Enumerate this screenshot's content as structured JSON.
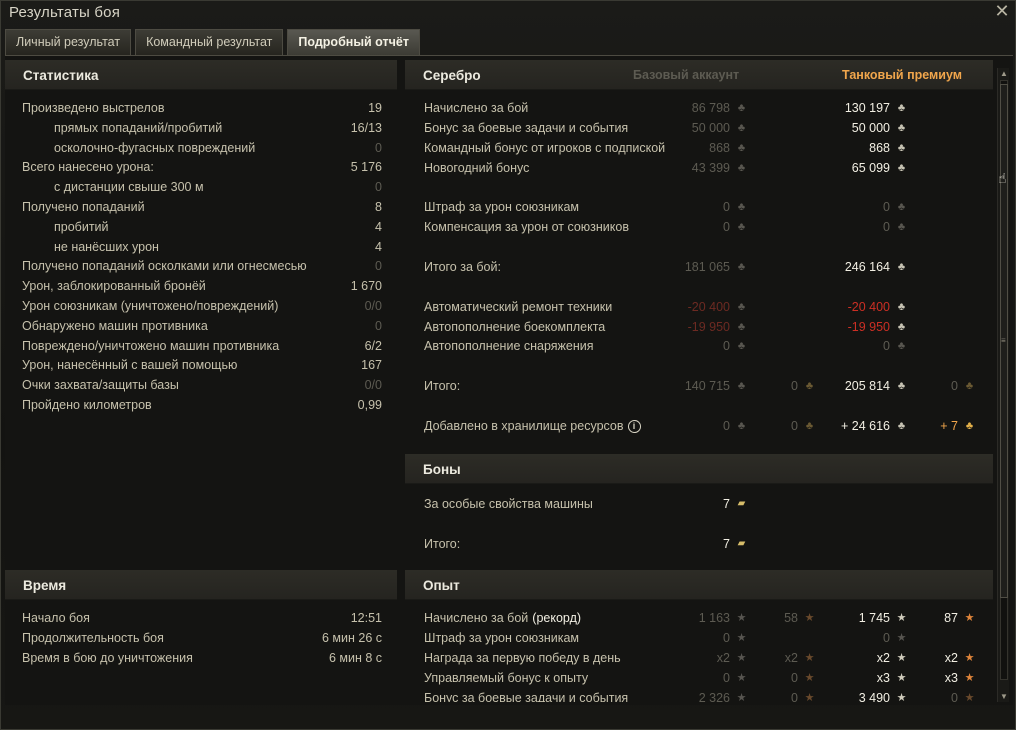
{
  "window": {
    "title": "Результаты боя"
  },
  "tabs": [
    {
      "label": "Личный результат",
      "active": false
    },
    {
      "label": "Командный результат",
      "active": false
    },
    {
      "label": "Подробный отчёт",
      "active": true
    }
  ],
  "statistics": {
    "header": "Статистика",
    "rows": [
      {
        "label": "Произведено выстрелов",
        "value": "19",
        "indent": false,
        "dim": false
      },
      {
        "label": "прямых попаданий/пробитий",
        "value": "16/13",
        "indent": true,
        "dim": false
      },
      {
        "label": "осколочно-фугасных повреждений",
        "value": "0",
        "indent": true,
        "dim": true
      },
      {
        "label": "Всего нанесено урона:",
        "value": "5 176",
        "indent": false,
        "dim": false
      },
      {
        "label": "с дистанции свыше 300 м",
        "value": "0",
        "indent": true,
        "dim": true
      },
      {
        "label": "Получено попаданий",
        "value": "8",
        "indent": false,
        "dim": false
      },
      {
        "label": "пробитий",
        "value": "4",
        "indent": true,
        "dim": false
      },
      {
        "label": "не нанёсших урон",
        "value": "4",
        "indent": true,
        "dim": false
      },
      {
        "label": "Получено попаданий осколками или огнесмесью",
        "value": "0",
        "indent": false,
        "dim": true
      },
      {
        "label": "Урон, заблокированный бронёй",
        "value": "1 670",
        "indent": false,
        "dim": false
      },
      {
        "label": "Урон союзникам (уничтожено/повреждений)",
        "value": "0/0",
        "indent": false,
        "dim": true
      },
      {
        "label": "Обнаружено машин противника",
        "value": "0",
        "indent": false,
        "dim": true
      },
      {
        "label": "Повреждено/уничтожено машин противника",
        "value": "6/2",
        "indent": false,
        "dim": false
      },
      {
        "label": "Урон, нанесённый с вашей помощью",
        "value": "167",
        "indent": false,
        "dim": false
      },
      {
        "label": "Очки захвата/защиты базы",
        "value": "0/0",
        "indent": false,
        "dim": true
      },
      {
        "label": "Пройдено километров",
        "value": "0,99",
        "indent": false,
        "dim": false
      }
    ]
  },
  "time": {
    "header": "Время",
    "rows": [
      {
        "label": "Начало боя",
        "value": "12:51"
      },
      {
        "label": "Продолжительность боя",
        "value": "6 мин 26 с"
      },
      {
        "label": "Время в бою до уничтожения",
        "value": "6 мин 8 с"
      }
    ]
  },
  "silver": {
    "header": "Серебро",
    "col_base": "Базовый аккаунт",
    "col_premium": "Танковый премиум",
    "rows": [
      {
        "label": "Начислено за бой",
        "base": "86 798",
        "base_gold": "",
        "prem": "130 197",
        "prem_gold": "",
        "base_style": "dim",
        "prem_style": "bright"
      },
      {
        "label": "Бонус за боевые задачи и события",
        "base": "50 000",
        "base_gold": "",
        "prem": "50 000",
        "prem_gold": "",
        "base_style": "dim",
        "prem_style": "bright"
      },
      {
        "label": "Командный бонус от игроков с подпиской",
        "base": "868",
        "base_gold": "",
        "prem": "868",
        "prem_gold": "",
        "base_style": "dim",
        "prem_style": "bright"
      },
      {
        "label": "Новогодний бонус",
        "base": "43 399",
        "base_gold": "",
        "prem": "65 099",
        "prem_gold": "",
        "base_style": "dim",
        "prem_style": "bright"
      },
      {
        "label": "Штраф за урон союзникам",
        "base": "0",
        "base_gold": "",
        "prem": "0",
        "prem_gold": "",
        "base_style": "dim",
        "prem_style": "dim"
      },
      {
        "label": "Компенсация за урон от союзников",
        "base": "0",
        "base_gold": "",
        "prem": "0",
        "prem_gold": "",
        "base_style": "dim",
        "prem_style": "dim"
      },
      {
        "label": "Итого за бой:",
        "base": "181 065",
        "base_gold": "",
        "prem": "246 164",
        "prem_gold": "",
        "base_style": "dim",
        "prem_style": "bright"
      },
      {
        "label": "Автоматический ремонт техники",
        "base": "-20 400",
        "base_gold": "",
        "prem": "-20 400",
        "prem_gold": "",
        "base_style": "dimred",
        "prem_style": "red"
      },
      {
        "label": "Автопополнение боекомплекта",
        "base": "-19 950",
        "base_gold": "",
        "prem": "-19 950",
        "prem_gold": "",
        "base_style": "dimred",
        "prem_style": "red"
      },
      {
        "label": "Автопополнение снаряжения",
        "base": "0",
        "base_gold": "",
        "prem": "0",
        "prem_gold": "",
        "base_style": "dim",
        "prem_style": "dim"
      },
      {
        "label": "Итого:",
        "base": "140 715",
        "base_gold": "0",
        "prem": "205 814",
        "prem_gold": "0",
        "base_style": "dim",
        "prem_style": "bright"
      },
      {
        "label": "Добавлено в хранилище ресурсов",
        "base": "0",
        "base_gold": "0",
        "prem": "+ 24 616",
        "prem_gold": "+ 7",
        "base_style": "dim",
        "prem_style": "bright",
        "info": true
      }
    ]
  },
  "bonds": {
    "header": "Боны",
    "rows": [
      {
        "label": "За особые свойства машины",
        "value": "7"
      },
      {
        "label": "Итого:",
        "value": "7"
      }
    ]
  },
  "experience": {
    "header": "Опыт",
    "rows": [
      {
        "label": "Начислено за бой",
        "label_extra": "(рекорд)",
        "base": "1 163",
        "base_free": "58",
        "prem": "1 745",
        "prem_free": "87",
        "base_style": "dim",
        "prem_style": "bright"
      },
      {
        "label": "Штраф за урон союзникам",
        "label_extra": "",
        "base": "0",
        "base_free": "",
        "prem": "0",
        "prem_free": "",
        "base_style": "dim",
        "prem_style": "dim"
      },
      {
        "label": "Награда за первую победу в день",
        "label_extra": "",
        "base": "x2",
        "base_free": "x2",
        "prem": "x2",
        "prem_free": "x2",
        "base_style": "dim",
        "prem_style": "bright"
      },
      {
        "label": "Управляемый бонус к опыту",
        "label_extra": "",
        "base": "0",
        "base_free": "0",
        "prem": "x3",
        "prem_free": "x3",
        "base_style": "dim",
        "prem_style": "bright"
      },
      {
        "label": "Бонус за боевые задачи и события",
        "label_extra": "",
        "base": "2 326",
        "base_free": "0",
        "prem": "3 490",
        "prem_free": "0",
        "base_style": "dim",
        "prem_style": "bright"
      }
    ]
  },
  "icons": {
    "silver": "silver-coin-icon",
    "gold": "gold-icon",
    "bond": "bond-icon",
    "xp": "xp-star-icon",
    "free_xp": "free-xp-star-icon",
    "close": "close-icon",
    "info": "info-icon"
  }
}
